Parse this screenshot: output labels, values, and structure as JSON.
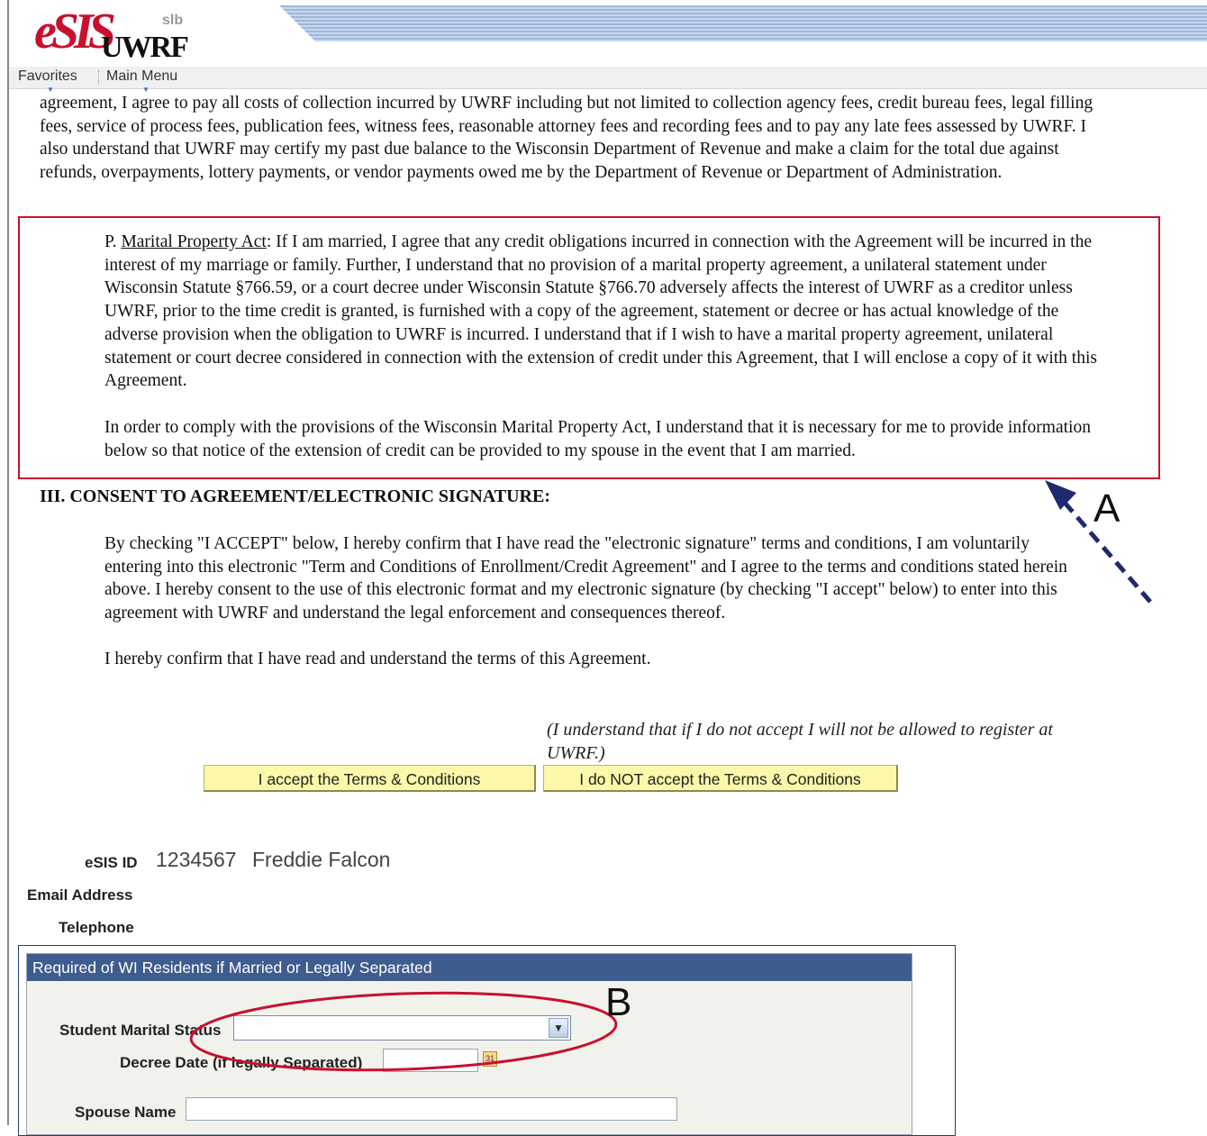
{
  "header": {
    "logo_main": "eSIS",
    "logo_sub": "slb",
    "logo_org": "UWRF",
    "menu": [
      "Favorites",
      "Main Menu"
    ]
  },
  "document": {
    "para_collection": "agreement, I agree to pay all costs of collection incurred by UWRF including but not limited to collection agency fees, credit bureau fees, legal filling fees, service of process fees, publication fees, witness fees, reasonable attorney fees and recording fees and to pay any late fees assessed by UWRF.  I also understand that UWRF  may certify my past due balance to the Wisconsin Department of Revenue and make a claim for the total due against refunds, overpayments, lottery payments, or vendor payments owed me by the Department of Revenue or Department of Administration.",
    "marital_prefix": "P. ",
    "marital_title": "Marital Property Act",
    "marital_text": ":   If I am married, I agree that any credit obligations incurred in connection with the Agreement will be incurred in the interest of my marriage or family.  Further, I understand that no provision of a marital property agreement, a unilateral statement under Wisconsin Statute §766.59, or a court decree under Wisconsin Statute §766.70 adversely affects the interest of UWRF as a creditor unless UWRF, prior to the time credit is granted, is furnished with a copy of the agreement, statement or decree or has actual knowledge of the adverse provision when the obligation to UWRF is incurred.  I understand that if I wish to have a marital property agreement, unilateral statement or court decree considered in connection with the extension of credit under this Agreement, that I will enclose a copy of it with this Agreement.",
    "marital_comply": "In order to comply with the provisions of the Wisconsin Marital Property Act, I understand that it is necessary for me to provide information below so that notice of the extension of credit can be provided to my spouse in the event that I am married.",
    "section_heading": "III. CONSENT TO AGREEMENT/ELECTRONIC SIGNATURE:",
    "consent_text": "By checking \"I ACCEPT\" below, I hereby confirm that I have read the \"electronic signature\" terms and conditions, I am voluntarily entering into this electronic \"Term and Conditions of Enrollment/Credit Agreement\" and I agree to the terms and conditions stated herein above. I hereby consent to the use of this electronic format and my electronic signature (by checking \"I accept\" below) to enter into this agreement with UWRF and understand the legal enforcement and consequences thereof.",
    "confirm_text": "I hereby confirm that I have read and understand the terms of this Agreement.",
    "decline_note": "(I understand that if I do not accept I will not be allowed to register at UWRF.)"
  },
  "buttons": {
    "accept": "I accept the Terms & Conditions",
    "decline": "I do NOT accept the Terms & Conditions"
  },
  "student": {
    "id_label": "eSIS ID",
    "id_value": "1234567",
    "name": "Freddie Falcon",
    "email_label": "Email Address",
    "phone_label": "Telephone"
  },
  "marital_group": {
    "header": "Required of WI Residents if Married or Legally Separated",
    "status_label": "Student Marital Status",
    "status_value": "",
    "decree_label": "Decree Date (if legally Separated)",
    "decree_value": "",
    "spouse_label": "Spouse Name",
    "spouse_value": ""
  },
  "annotations": {
    "a": "A",
    "b": "B",
    "box_color": "#c8102e",
    "arrow_color": "#1f2a6e"
  }
}
